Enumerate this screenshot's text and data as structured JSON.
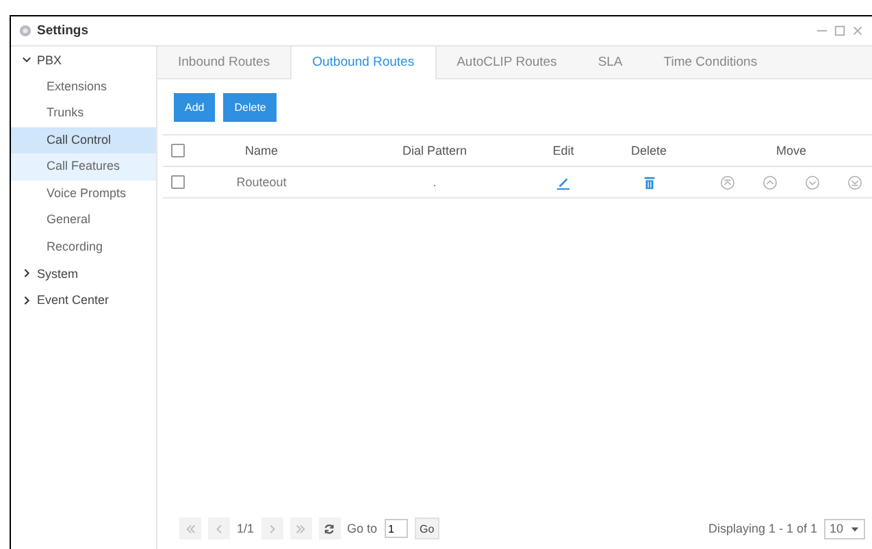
{
  "window": {
    "title": "Settings"
  },
  "sidebar": [
    {
      "label": "PBX",
      "expanded": true,
      "children": [
        {
          "label": "Extensions",
          "selected": false,
          "hovered": false
        },
        {
          "label": "Trunks",
          "selected": false,
          "hovered": false
        },
        {
          "label": "Call Control",
          "selected": true,
          "hovered": false
        },
        {
          "label": "Call Features",
          "selected": false,
          "hovered": true
        },
        {
          "label": "Voice Prompts",
          "selected": false,
          "hovered": false
        },
        {
          "label": "General",
          "selected": false,
          "hovered": false
        },
        {
          "label": "Recording",
          "selected": false,
          "hovered": false
        }
      ]
    },
    {
      "label": "System",
      "expanded": false
    },
    {
      "label": "Event Center",
      "expanded": false
    }
  ],
  "tabs": [
    {
      "label": "Inbound Routes",
      "selected": false
    },
    {
      "label": "Outbound Routes",
      "selected": true
    },
    {
      "label": "AutoCLIP Routes",
      "selected": false
    },
    {
      "label": "SLA",
      "selected": false
    },
    {
      "label": "Time Conditions",
      "selected": false
    }
  ],
  "buttons": [
    "Add",
    "Delete"
  ],
  "table": {
    "header_checked": false,
    "columns": [
      "Name",
      "Dial Pattern",
      "Edit",
      "Delete",
      "Move"
    ],
    "rows": [
      {
        "checked": false,
        "name": "Routeout",
        "dial_pattern": "."
      }
    ]
  },
  "pagination": {
    "page": "1/1",
    "goto_label": "Go to",
    "goto_value": "1",
    "go": "Go",
    "display": "Displaying 1 - 1 of 1",
    "page_size": "10"
  }
}
